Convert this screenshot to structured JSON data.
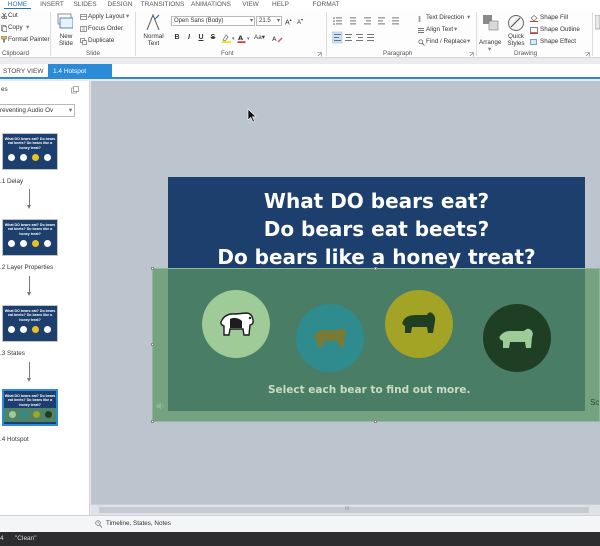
{
  "ribbon": {
    "tabs": [
      "HOME",
      "INSERT",
      "SLIDES",
      "DESIGN",
      "TRANSITIONS",
      "ANIMATIONS",
      "VIEW",
      "HELP",
      "FORMAT"
    ],
    "clipboard": {
      "cut": "Cut",
      "copy": "Copy",
      "format_painter": "Format Painter",
      "label": "Clipboard"
    },
    "slide": {
      "new_slide": "New Slide",
      "apply_layout": "Apply Layout",
      "focus_order": "Focus Order",
      "duplicate": "Duplicate",
      "label": "Slide"
    },
    "font": {
      "style_name": "Normal Text",
      "family": "Open Sans (Body)",
      "size": "21.5",
      "label": "Font",
      "bold": "B",
      "italic": "I",
      "underline": "U",
      "strike": "S",
      "aa": "Aa"
    },
    "paragraph": {
      "text_direction": "Text Direction",
      "align_text": "Align Text",
      "find_replace": "Find / Replace",
      "label": "Paragraph"
    },
    "drawing": {
      "arrange": "Arrange",
      "quick_styles": "Quick Styles",
      "shape_fill": "Shape Fill",
      "shape_outline": "Shape Outline",
      "shape_effect": "Shape Effect",
      "label": "Drawing"
    }
  },
  "doc_tabs": {
    "story_view": "STORY VIEW",
    "current": "1.4 Hotspot"
  },
  "slides_panel": {
    "header": "es",
    "scene_dropdown": "reventing Audio Ov",
    "slides": [
      {
        "label": ".1 Delay"
      },
      {
        "label": ".2 Layer Properties"
      },
      {
        "label": ".3 States"
      },
      {
        "label": ".4 Hotspot"
      }
    ],
    "thumb_title": "What DO bears eat? Do bears eat beets? Do bears like a honey treat?"
  },
  "slide": {
    "title_lines": [
      "What DO bears eat?",
      "Do bears eat beets?",
      "Do bears like a honey treat?"
    ],
    "caption": "Select each bear to find out more.",
    "side_text": "Sc",
    "colors": {
      "background": "#1d3f6e",
      "hotspot": "#5a9664",
      "circle1": "#9ecb98",
      "circle2": "#2e8b8e",
      "circle3": "#a3a326",
      "circle4": "#1f3f24"
    }
  },
  "timeline_label": "Timeline, States, Notes",
  "status": {
    "left": "4",
    "clean": "\"Clean\""
  }
}
